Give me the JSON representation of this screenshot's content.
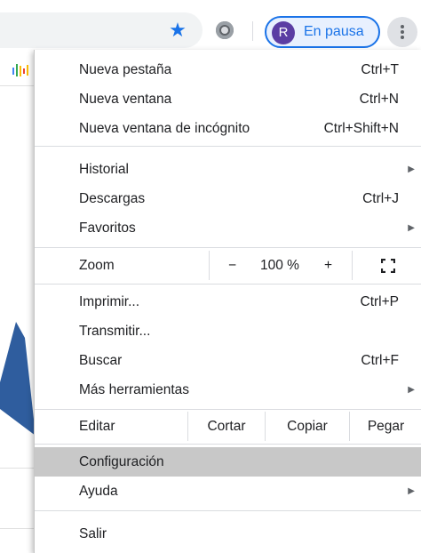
{
  "toolbar": {
    "profile_initial": "R",
    "profile_label": "En pausa",
    "accent": "#1a73e8"
  },
  "menu": {
    "nueva_pestana": {
      "label": "Nueva pestaña",
      "shortcut": "Ctrl+T"
    },
    "nueva_ventana": {
      "label": "Nueva ventana",
      "shortcut": "Ctrl+N"
    },
    "incognito": {
      "label": "Nueva ventana de incógnito",
      "shortcut": "Ctrl+Shift+N"
    },
    "historial": {
      "label": "Historial"
    },
    "descargas": {
      "label": "Descargas",
      "shortcut": "Ctrl+J"
    },
    "favoritos": {
      "label": "Favoritos"
    },
    "zoom": {
      "label": "Zoom",
      "minus": "−",
      "value": "100 %",
      "plus": "+"
    },
    "imprimir": {
      "label": "Imprimir...",
      "shortcut": "Ctrl+P"
    },
    "transmitir": {
      "label": "Transmitir..."
    },
    "buscar": {
      "label": "Buscar",
      "shortcut": "Ctrl+F"
    },
    "mas_herramientas": {
      "label": "Más herramientas"
    },
    "editar": {
      "label": "Editar",
      "cortar": "Cortar",
      "copiar": "Copiar",
      "pegar": "Pegar"
    },
    "configuracion": {
      "label": "Configuración"
    },
    "ayuda": {
      "label": "Ayuda"
    },
    "salir": {
      "label": "Salir"
    }
  },
  "colors": {
    "highlight": "#c8c8c8",
    "arrow": "#2f5d9e"
  }
}
